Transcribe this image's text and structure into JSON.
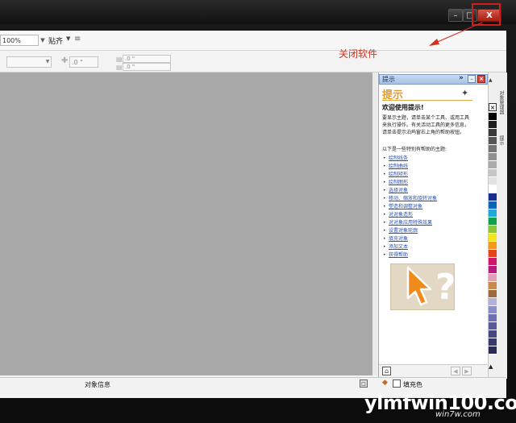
{
  "annotation": {
    "text": "关闭软件",
    "color": "#d82f1d"
  },
  "window": {
    "minimize_icon": "minimize-icon",
    "maximize_icon": "maximize-icon",
    "close_label": "X"
  },
  "toolbar": {
    "zoom_value": "100%",
    "snap_label": "贴齐",
    "nudge_value": ".0 \"",
    "dup_x_value": ".0 \"",
    "dup_y_value": ".0 \""
  },
  "docker": {
    "header_title": "提示",
    "expand_label": "»",
    "heading": "提示",
    "welcome": "欢迎使用提示!",
    "body": "要显示主题，请单击某个工具、或用工具来执行操作。有关活动工具的更多信息，请单击提示泊坞窗右上角的帮助按钮。",
    "intro": "以下是一些特别有帮助的主题:",
    "links": [
      "绘制线条",
      "绘制曲线",
      "绘制矩形",
      "绘制图形",
      "选择对象",
      "移动、缩放和旋转对象",
      "塑造和调整对象",
      "对对象造形",
      "对对象应用特殊效果",
      "设置对象轮廓",
      "填充对象",
      "添加文本",
      "获得帮助"
    ]
  },
  "tabs": {
    "tab1": "对象管理器",
    "tab2": "提示"
  },
  "palette": [
    "#000000",
    "#202020",
    "#3a3a3a",
    "#575757",
    "#747474",
    "#8f8f8f",
    "#ababab",
    "#c6c6c6",
    "#e2e2e2",
    "#ffffff",
    "#1a2c8a",
    "#0d63b8",
    "#1fa9d8",
    "#12a04a",
    "#8cc43a",
    "#f3e51d",
    "#f39a1d",
    "#e8441c",
    "#d0186a",
    "#b81c7a",
    "#e2a0b8",
    "#c98a4e",
    "#9a6b3e",
    "#b2b2d8",
    "#8c8cc8",
    "#6e6eb0",
    "#5a5a98",
    "#484880",
    "#3a3a6a",
    "#2c2c52"
  ],
  "status": {
    "object_info": "对象信息",
    "fill_label": "填充色"
  },
  "watermark": {
    "main": "ylmfwin100.com",
    "sub": "win7w.com"
  }
}
